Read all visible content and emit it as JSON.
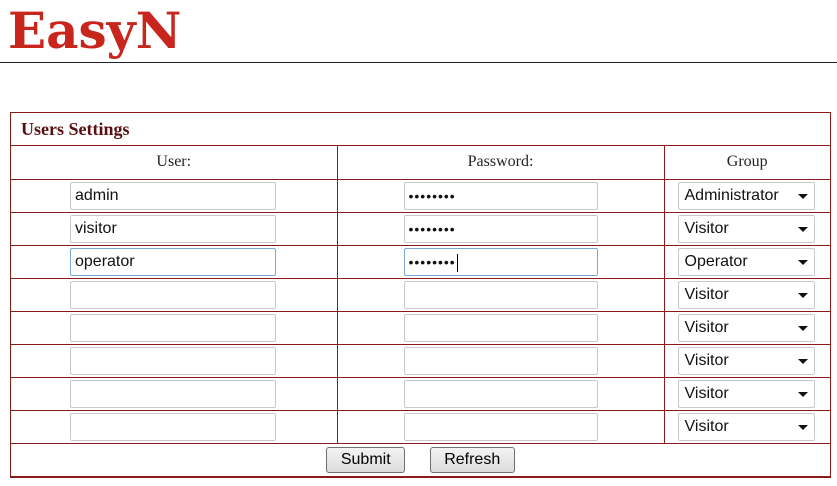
{
  "brand": {
    "logo_text": "EasyN"
  },
  "panel": {
    "title": "Users Settings",
    "headers": {
      "user": "User:",
      "password": "Password:",
      "group": "Group"
    }
  },
  "rows": [
    {
      "user": "admin",
      "password": "••••••••",
      "group": "Administrator",
      "focused": false
    },
    {
      "user": "visitor",
      "password": "••••••••",
      "group": "Visitor",
      "focused": false
    },
    {
      "user": "operator",
      "password": "••••••••",
      "group": "Operator",
      "focused": true
    },
    {
      "user": "",
      "password": "",
      "group": "Visitor",
      "focused": false
    },
    {
      "user": "",
      "password": "",
      "group": "Visitor",
      "focused": false
    },
    {
      "user": "",
      "password": "",
      "group": "Visitor",
      "focused": false
    },
    {
      "user": "",
      "password": "",
      "group": "Visitor",
      "focused": false
    },
    {
      "user": "",
      "password": "",
      "group": "Visitor",
      "focused": false
    }
  ],
  "buttons": {
    "submit": "Submit",
    "refresh": "Refresh"
  },
  "colors": {
    "brand_red": "#c8251c",
    "panel_border": "#8b1a1a",
    "title_text": "#5a1010"
  }
}
